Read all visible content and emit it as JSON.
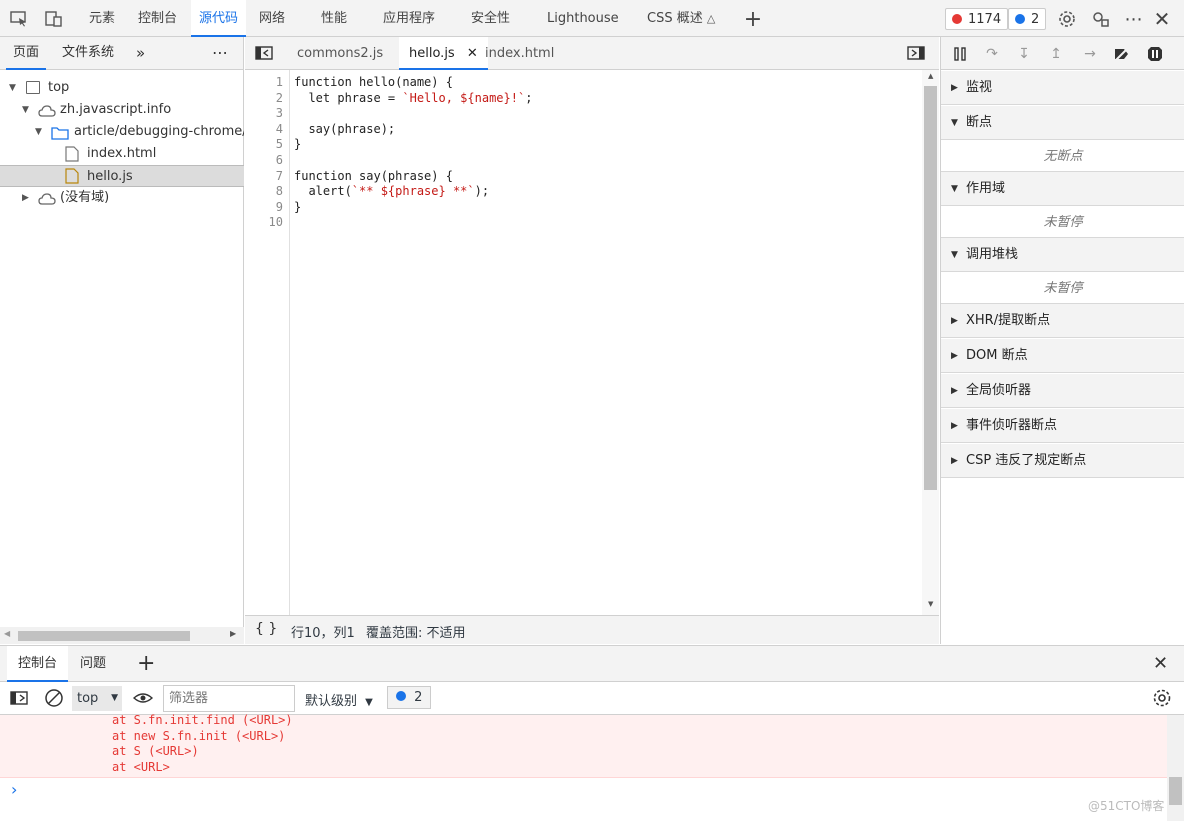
{
  "toolbar": {
    "tabs": [
      {
        "label": "元素",
        "active": false
      },
      {
        "label": "控制台",
        "active": false
      },
      {
        "label": "源代码",
        "active": true
      },
      {
        "label": "网络",
        "active": false
      },
      {
        "label": "性能",
        "active": false
      },
      {
        "label": "应用程序",
        "active": false
      },
      {
        "label": "安全性",
        "active": false
      },
      {
        "label": "Lighthouse",
        "active": false
      },
      {
        "label": "CSS 概述",
        "active": false
      }
    ],
    "error_count": "1174",
    "message_count": "2"
  },
  "navigator": {
    "tabs": [
      {
        "label": "页面",
        "active": true
      },
      {
        "label": "文件系统",
        "active": false
      }
    ],
    "tree": [
      {
        "label": "top",
        "type": "frame"
      },
      {
        "label": "zh.javascript.info",
        "type": "domain"
      },
      {
        "label": "article/debugging-chrome/de",
        "type": "folder"
      },
      {
        "label": "index.html",
        "type": "file"
      },
      {
        "label": "hello.js",
        "type": "file",
        "selected": true
      },
      {
        "label": "(没有域)",
        "type": "domain"
      }
    ]
  },
  "editor": {
    "tabs": [
      {
        "label": "commons2.js",
        "active": false
      },
      {
        "label": "hello.js",
        "active": true,
        "closable": true
      },
      {
        "label": "index.html",
        "active": false
      }
    ],
    "code_lines": [
      [
        "function hello(name) {"
      ],
      [
        "  let phrase = ",
        "`Hello, ${name}!`",
        ";"
      ],
      [
        ""
      ],
      [
        "  say(phrase);"
      ],
      [
        "}"
      ],
      [
        ""
      ],
      [
        "function say(phrase) {"
      ],
      [
        "  alert(",
        "`** ${phrase} **`",
        ");"
      ],
      [
        "}"
      ],
      [
        ""
      ]
    ],
    "line_numbers": [
      "1",
      "2",
      "3",
      "4",
      "5",
      "6",
      "7",
      "8",
      "9",
      "10"
    ],
    "status": {
      "format_label": "{ }",
      "position": "行10，列1",
      "coverage": "覆盖范围: 不适用"
    }
  },
  "debugger": {
    "panes": [
      {
        "label": "监视",
        "expanded": false,
        "body": null
      },
      {
        "label": "断点",
        "expanded": true,
        "body": "无断点"
      },
      {
        "label": "作用域",
        "expanded": true,
        "body": "未暂停"
      },
      {
        "label": "调用堆栈",
        "expanded": true,
        "body": "未暂停"
      },
      {
        "label": "XHR/提取断点",
        "expanded": false,
        "body": null
      },
      {
        "label": "DOM 断点",
        "expanded": false,
        "body": null
      },
      {
        "label": "全局侦听器",
        "expanded": false,
        "body": null
      },
      {
        "label": "事件侦听器断点",
        "expanded": false,
        "body": null
      },
      {
        "label": "CSP 违反了规定断点",
        "expanded": false,
        "body": null
      }
    ]
  },
  "drawer": {
    "tabs": [
      {
        "label": "控制台",
        "active": true
      },
      {
        "label": "问题",
        "active": false
      }
    ],
    "context": "top",
    "filter_placeholder": "筛选器",
    "level": "默认级别",
    "message_count": "2",
    "error_lines": [
      "at S.fn.init.find (<URL>)",
      "at new S.fn.init (<URL>)",
      "at S (<URL>)",
      "at <URL>"
    ],
    "prompt": "›"
  },
  "watermark": "@51CTO博客",
  "colors": {
    "accent": "#1a73e8",
    "error_text": "#e53935",
    "error_bg": "#fff0f0",
    "string": "#c41a16"
  }
}
